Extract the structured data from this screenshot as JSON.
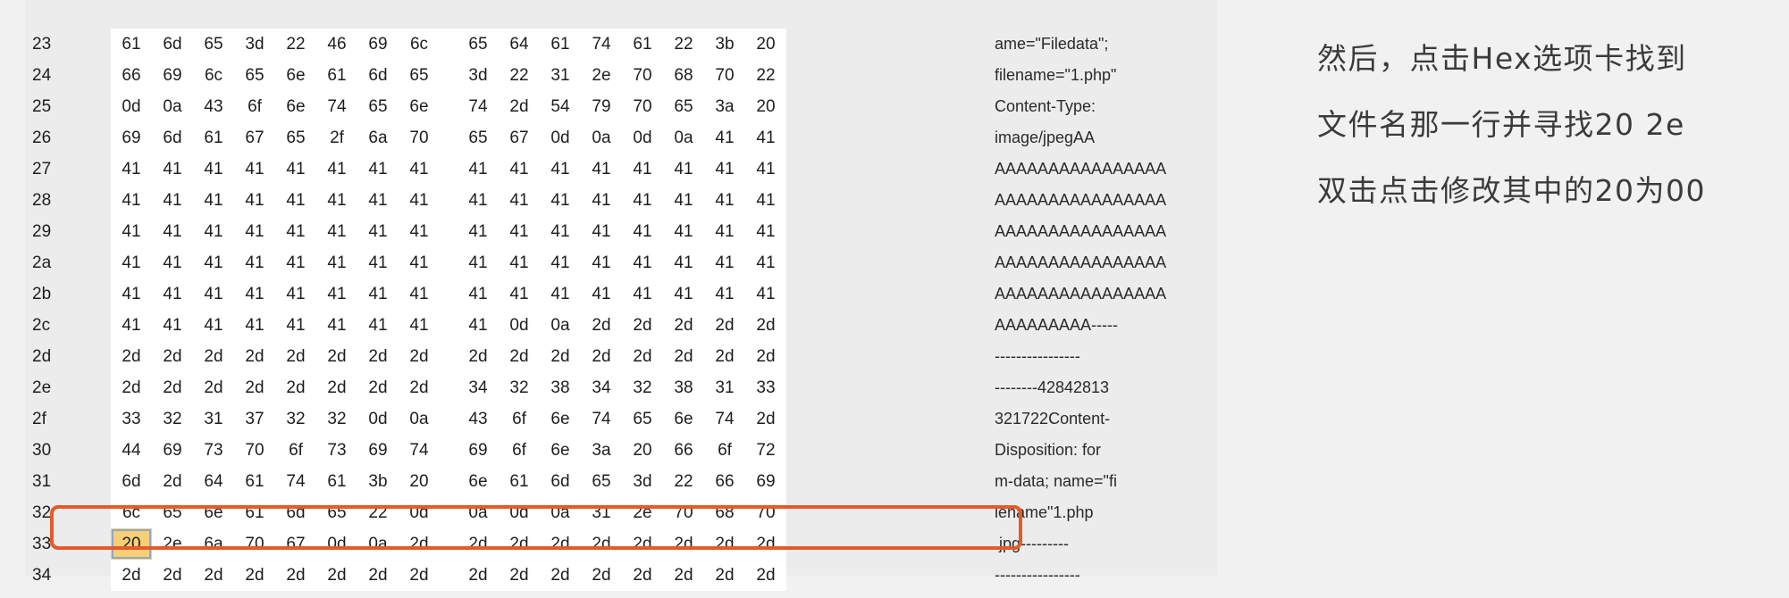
{
  "hex_view": {
    "rows": [
      {
        "offset": "23",
        "bytes": [
          "61",
          "6d",
          "65",
          "3d",
          "22",
          "46",
          "69",
          "6c",
          "65",
          "64",
          "61",
          "74",
          "61",
          "22",
          "3b",
          "20"
        ],
        "ascii": "ame=\"Filedata\";"
      },
      {
        "offset": "24",
        "bytes": [
          "66",
          "69",
          "6c",
          "65",
          "6e",
          "61",
          "6d",
          "65",
          "3d",
          "22",
          "31",
          "2e",
          "70",
          "68",
          "70",
          "22"
        ],
        "ascii": "filename=\"1.php\""
      },
      {
        "offset": "25",
        "bytes": [
          "0d",
          "0a",
          "43",
          "6f",
          "6e",
          "74",
          "65",
          "6e",
          "74",
          "2d",
          "54",
          "79",
          "70",
          "65",
          "3a",
          "20"
        ],
        "ascii": "Content-Type:"
      },
      {
        "offset": "26",
        "bytes": [
          "69",
          "6d",
          "61",
          "67",
          "65",
          "2f",
          "6a",
          "70",
          "65",
          "67",
          "0d",
          "0a",
          "0d",
          "0a",
          "41",
          "41"
        ],
        "ascii": "image/jpegAA"
      },
      {
        "offset": "27",
        "bytes": [
          "41",
          "41",
          "41",
          "41",
          "41",
          "41",
          "41",
          "41",
          "41",
          "41",
          "41",
          "41",
          "41",
          "41",
          "41",
          "41"
        ],
        "ascii": "AAAAAAAAAAAAAAAA"
      },
      {
        "offset": "28",
        "bytes": [
          "41",
          "41",
          "41",
          "41",
          "41",
          "41",
          "41",
          "41",
          "41",
          "41",
          "41",
          "41",
          "41",
          "41",
          "41",
          "41"
        ],
        "ascii": "AAAAAAAAAAAAAAAA"
      },
      {
        "offset": "29",
        "bytes": [
          "41",
          "41",
          "41",
          "41",
          "41",
          "41",
          "41",
          "41",
          "41",
          "41",
          "41",
          "41",
          "41",
          "41",
          "41",
          "41"
        ],
        "ascii": "AAAAAAAAAAAAAAAA"
      },
      {
        "offset": "2a",
        "bytes": [
          "41",
          "41",
          "41",
          "41",
          "41",
          "41",
          "41",
          "41",
          "41",
          "41",
          "41",
          "41",
          "41",
          "41",
          "41",
          "41"
        ],
        "ascii": "AAAAAAAAAAAAAAAA"
      },
      {
        "offset": "2b",
        "bytes": [
          "41",
          "41",
          "41",
          "41",
          "41",
          "41",
          "41",
          "41",
          "41",
          "41",
          "41",
          "41",
          "41",
          "41",
          "41",
          "41"
        ],
        "ascii": "AAAAAAAAAAAAAAAA"
      },
      {
        "offset": "2c",
        "bytes": [
          "41",
          "41",
          "41",
          "41",
          "41",
          "41",
          "41",
          "41",
          "41",
          "0d",
          "0a",
          "2d",
          "2d",
          "2d",
          "2d",
          "2d"
        ],
        "ascii": "AAAAAAAAA-----"
      },
      {
        "offset": "2d",
        "bytes": [
          "2d",
          "2d",
          "2d",
          "2d",
          "2d",
          "2d",
          "2d",
          "2d",
          "2d",
          "2d",
          "2d",
          "2d",
          "2d",
          "2d",
          "2d",
          "2d"
        ],
        "ascii": "----------------"
      },
      {
        "offset": "2e",
        "bytes": [
          "2d",
          "2d",
          "2d",
          "2d",
          "2d",
          "2d",
          "2d",
          "2d",
          "34",
          "32",
          "38",
          "34",
          "32",
          "38",
          "31",
          "33"
        ],
        "ascii": "--------42842813"
      },
      {
        "offset": "2f",
        "bytes": [
          "33",
          "32",
          "31",
          "37",
          "32",
          "32",
          "0d",
          "0a",
          "43",
          "6f",
          "6e",
          "74",
          "65",
          "6e",
          "74",
          "2d"
        ],
        "ascii": "321722Content-"
      },
      {
        "offset": "30",
        "bytes": [
          "44",
          "69",
          "73",
          "70",
          "6f",
          "73",
          "69",
          "74",
          "69",
          "6f",
          "6e",
          "3a",
          "20",
          "66",
          "6f",
          "72"
        ],
        "ascii": "Disposition: for"
      },
      {
        "offset": "31",
        "bytes": [
          "6d",
          "2d",
          "64",
          "61",
          "74",
          "61",
          "3b",
          "20",
          "6e",
          "61",
          "6d",
          "65",
          "3d",
          "22",
          "66",
          "69"
        ],
        "ascii": "m-data; name=\"fi"
      },
      {
        "offset": "32",
        "bytes": [
          "6c",
          "65",
          "6e",
          "61",
          "6d",
          "65",
          "22",
          "0d",
          "0a",
          "0d",
          "0a",
          "31",
          "2e",
          "70",
          "68",
          "70"
        ],
        "ascii": "lename\"1.php"
      },
      {
        "offset": "33",
        "bytes": [
          "20",
          "2e",
          "6a",
          "70",
          "67",
          "0d",
          "0a",
          "2d",
          "2d",
          "2d",
          "2d",
          "2d",
          "2d",
          "2d",
          "2d",
          "2d"
        ],
        "ascii": ".jpg---------"
      },
      {
        "offset": "34",
        "bytes": [
          "2d",
          "2d",
          "2d",
          "2d",
          "2d",
          "2d",
          "2d",
          "2d",
          "2d",
          "2d",
          "2d",
          "2d",
          "2d",
          "2d",
          "2d",
          "2d"
        ],
        "ascii": "----------------"
      }
    ],
    "selected_byte": {
      "row_offset": "33",
      "column": 0,
      "value": "20"
    }
  },
  "instructions": {
    "line1": "然后，点击Hex选项卡找到",
    "line2": "文件名那一行并寻找20 2e",
    "line3": "双击点击修改其中的20为00"
  },
  "colors": {
    "highlight_border": "#e45b2b",
    "selected_cell": "#f7cf77"
  }
}
